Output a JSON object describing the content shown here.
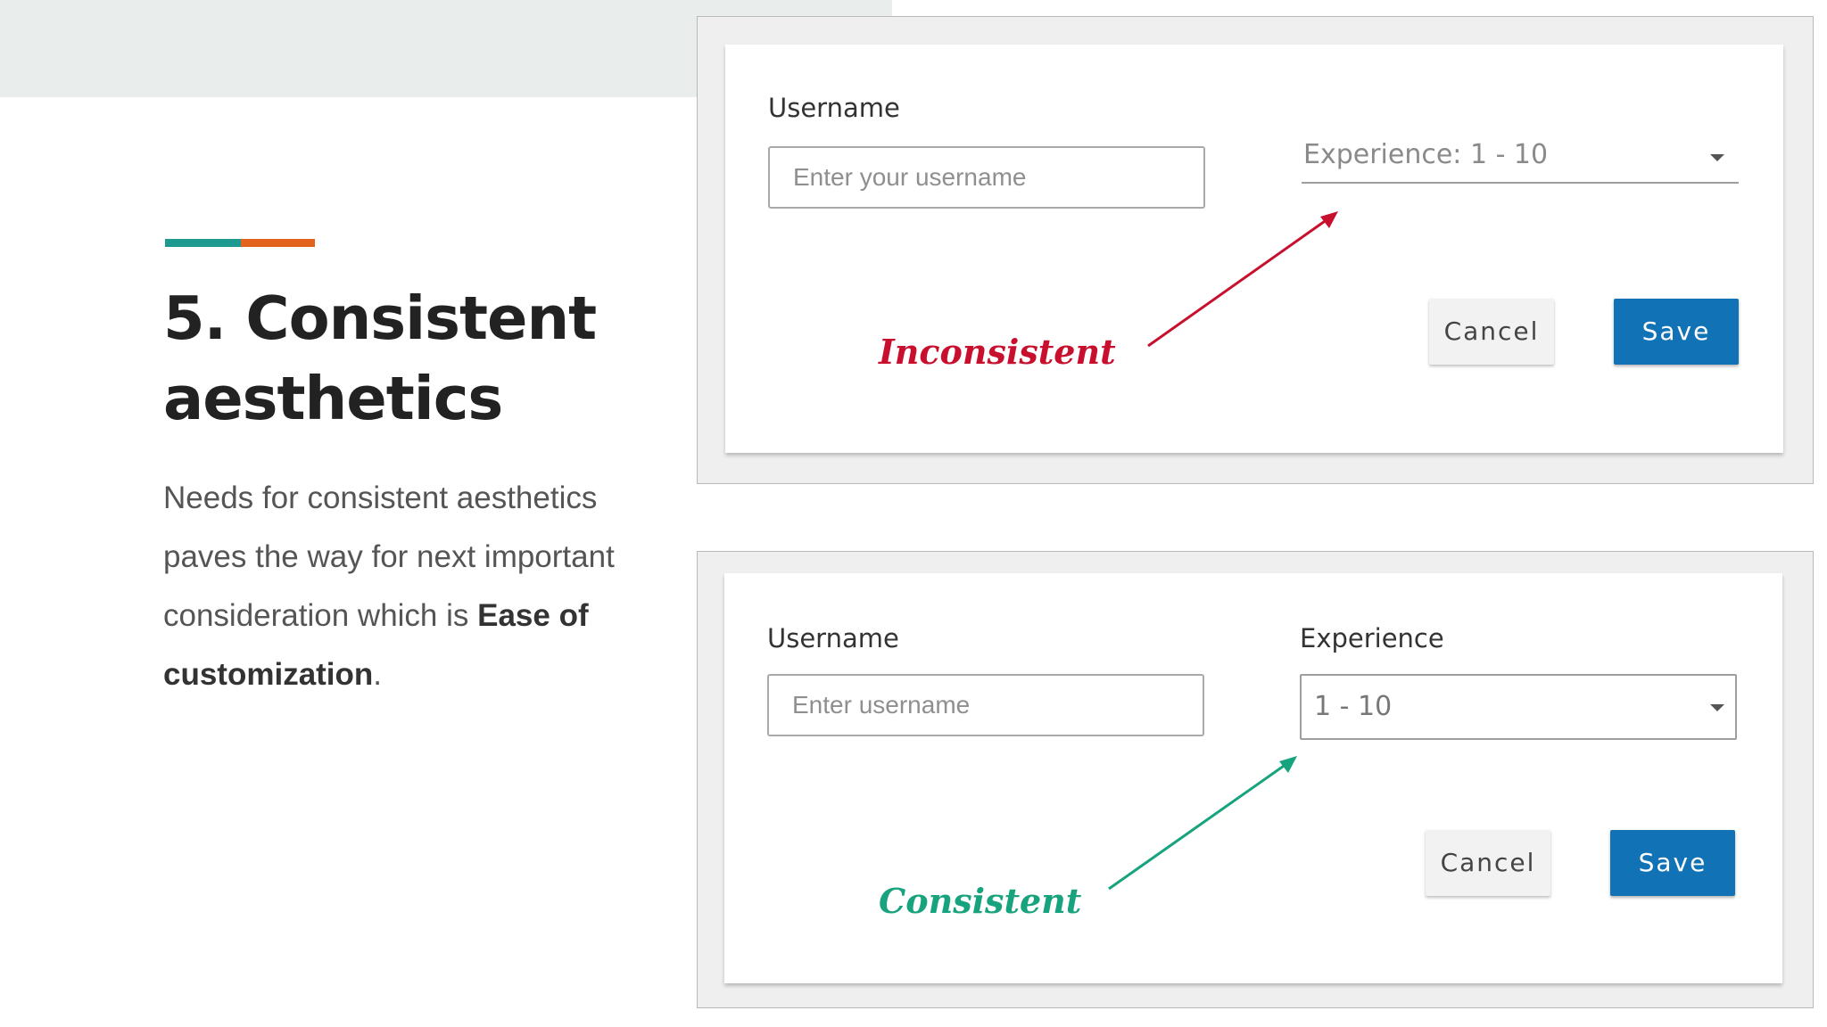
{
  "slide": {
    "title_line1": "5. Consistent",
    "title_line2": "aesthetics",
    "body_text": "Needs for consistent aesthetics paves the way for next important consideration which is ",
    "body_bold": "Ease of customization",
    "body_end": ".",
    "accent_colors": [
      "#1d9a8f",
      "#e2641c"
    ]
  },
  "top_example": {
    "username_label": "Username",
    "username_placeholder": "Enter your username",
    "experience_select": "Experience: 1 - 10",
    "cancel_label": "Cancel",
    "save_label": "Save",
    "annotation": "Inconsistent",
    "annotation_color": "#c8102e"
  },
  "bottom_example": {
    "username_label": "Username",
    "username_placeholder": "Enter username",
    "experience_label": "Experience",
    "experience_select": "1 - 10",
    "cancel_label": "Cancel",
    "save_label": "Save",
    "annotation": "Consistent",
    "annotation_color": "#17a37e"
  }
}
